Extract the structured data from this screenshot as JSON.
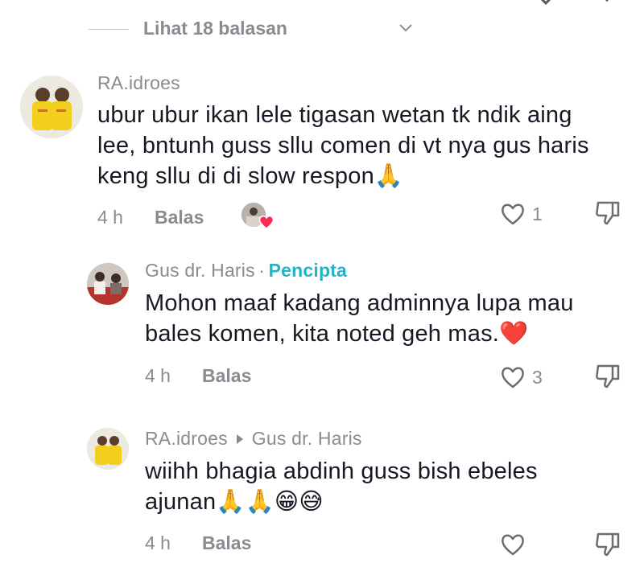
{
  "thread": {
    "view_replies_label": "Lihat 18 balasan"
  },
  "comments": [
    {
      "author": "RA.idroes",
      "text_lines": [
        "ubur ubur ikan lele tigasan wetan tk ndik aing",
        "lee, bntunh guss sllu comen di vt nya gus haris",
        "keng sllu di di slow respon"
      ],
      "emoji": [
        "🙏"
      ],
      "time": "4 h",
      "reply_label": "Balas",
      "like_count": "1"
    },
    {
      "author": "Gus dr. Haris",
      "separator": "·",
      "creator_badge": "Pencipta",
      "text_lines": [
        "Mohon maaf kadang adminnya lupa mau",
        "bales komen, kita noted geh mas."
      ],
      "emoji": [
        "❤️"
      ],
      "time": "4 h",
      "reply_label": "Balas",
      "like_count": "3"
    },
    {
      "author": "RA.idroes",
      "reply_to": "Gus dr. Haris",
      "text_lines": [
        "wiihh bhagia abdinh guss bish ebeles",
        "ajunan"
      ],
      "emoji": [
        "🙏",
        "🙏",
        "😁",
        "😅"
      ],
      "time": "4 h",
      "reply_label": "Balas",
      "like_count": ""
    }
  ],
  "colors": {
    "creator_badge": "#23b3c6",
    "heart_reaction": "#fe2c55",
    "text": "#161823",
    "muted": "#8a8b91"
  }
}
